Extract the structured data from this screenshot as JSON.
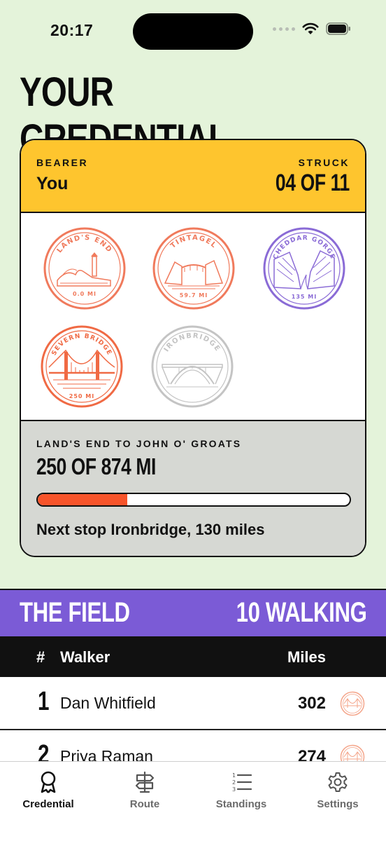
{
  "status_bar": {
    "time": "20:17"
  },
  "page_title": "YOUR CREDENTIAL",
  "credential": {
    "bearer_label": "BEARER",
    "bearer_value": "You",
    "struck_label": "STRUCK",
    "struck_value": "04 OF 11",
    "stamps": [
      {
        "name": "LAND'S END",
        "miles": "0.0 MI",
        "color": "#f07a5c",
        "state": "struck"
      },
      {
        "name": "TINTAGEL",
        "miles": "59.7 MI",
        "color": "#f07a5c",
        "state": "struck"
      },
      {
        "name": "CHEDDAR GORGE",
        "miles": "135 MI",
        "color": "#8a6bd6",
        "state": "struck"
      },
      {
        "name": "SEVERN BRIDGE",
        "miles": "250 MI",
        "color": "#f06a44",
        "state": "struck"
      },
      {
        "name": "IRONBRIDGE",
        "miles": "",
        "color": "#c4c4c4",
        "state": "pending"
      }
    ],
    "route_label": "LAND'S END TO JOHN O' GROATS",
    "route_progress": "250 OF 874 MI",
    "progress_fraction": 0.286,
    "next_stop": "Next stop Ironbridge, 130 miles"
  },
  "field": {
    "title": "THE FIELD",
    "count": "10 WALKING",
    "columns": {
      "rank": "#",
      "walker": "Walker",
      "miles": "Miles"
    },
    "rows": [
      {
        "rank": "1",
        "name": "Dan Whitfield",
        "miles": "302"
      },
      {
        "rank": "2",
        "name": "Priya Raman",
        "miles": "274"
      }
    ]
  },
  "tabs": [
    {
      "label": "Credential",
      "icon": "ribbon-badge-icon",
      "active": true
    },
    {
      "label": "Route",
      "icon": "signpost-icon",
      "active": false
    },
    {
      "label": "Standings",
      "icon": "numbered-list-icon",
      "active": false
    },
    {
      "label": "Settings",
      "icon": "gear-icon",
      "active": false
    }
  ],
  "colors": {
    "background": "#e4f3da",
    "card_header": "#fec52e",
    "progress_fill": "#f7542a",
    "field_header": "#7b5bd6"
  }
}
